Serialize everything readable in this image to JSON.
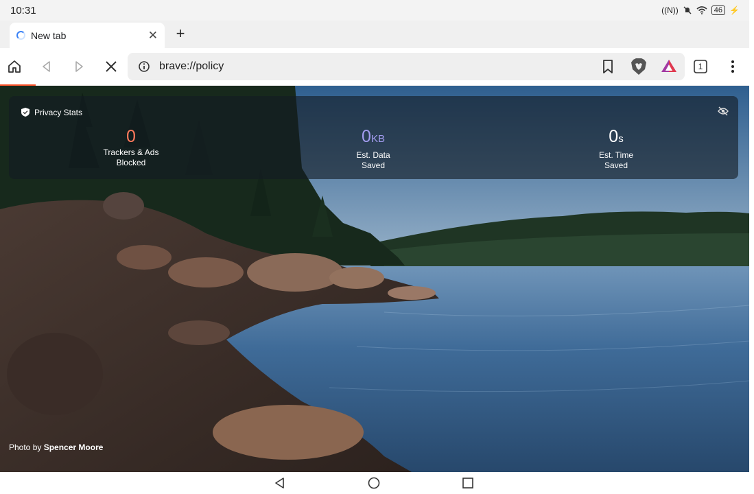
{
  "status_bar": {
    "time": "10:31",
    "battery": "46",
    "icons": [
      "nfc-icon",
      "mute-icon",
      "wifi-icon",
      "battery-icon",
      "charging-icon"
    ]
  },
  "tab": {
    "title": "New tab",
    "close_icon": "close-icon"
  },
  "toolbar": {
    "url": "brave://policy",
    "tab_count": "1"
  },
  "stats": {
    "heading": "Privacy Stats",
    "trackers_value": "0",
    "trackers_label_1": "Trackers & Ads",
    "trackers_label_2": "Blocked",
    "data_value": "0",
    "data_unit": "KB",
    "data_label_1": "Est. Data",
    "data_label_2": "Saved",
    "time_value": "0",
    "time_unit": "s",
    "time_label_1": "Est. Time",
    "time_label_2": "Saved"
  },
  "credit": {
    "prefix": "Photo by",
    "author": "Spencer Moore"
  },
  "colors": {
    "accent": "#fb542b",
    "trackers": "#ff7a5c",
    "data": "#a39cf0",
    "time": "#ffffff"
  }
}
